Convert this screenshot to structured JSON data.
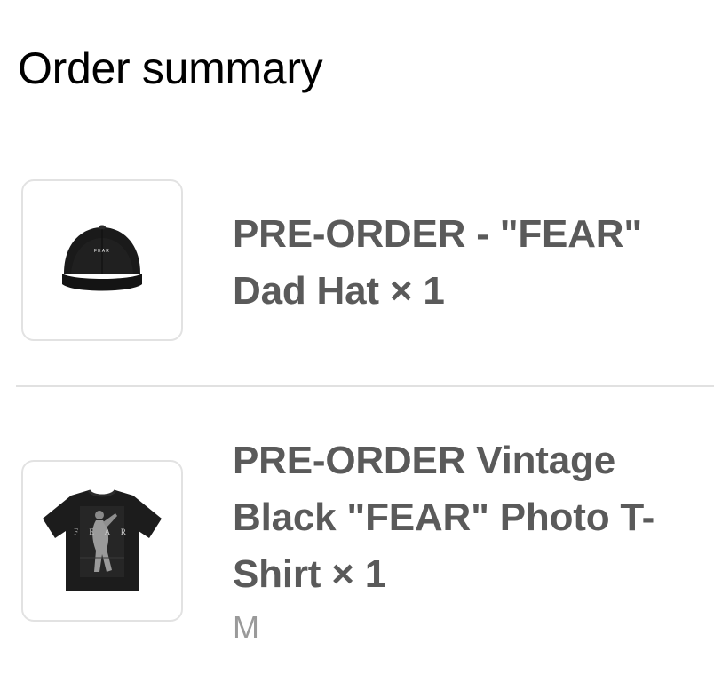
{
  "header": {
    "title": "Order summary"
  },
  "items": [
    {
      "name": "PRE-ORDER - \"FEAR\" Dad Hat",
      "name_line1": "PRE-ORDER - \"FEAR\"",
      "name_line2": "Dad Hat × 1",
      "quantity": "1",
      "variant": "",
      "image": {
        "icon": "black-dad-hat-image",
        "print_text": "FEAR"
      }
    },
    {
      "name": "PRE-ORDER Vintage Black \"FEAR\" Photo T-Shirt",
      "name_line1": "PRE-ORDER Vintage",
      "name_line2": "Black \"FEAR\" Photo T-",
      "name_line3": "Shirt × 1",
      "quantity": "1",
      "variant": "M",
      "image": {
        "icon": "black-photo-tshirt-image",
        "print_text": "F E A R"
      }
    }
  ],
  "colors": {
    "title": "#000000",
    "item_name": "#5a5a5a",
    "variant": "#9a9a9a",
    "border": "#e2e2e2",
    "divider": "#e1e1e1",
    "product_black": "#1a1a1a"
  }
}
